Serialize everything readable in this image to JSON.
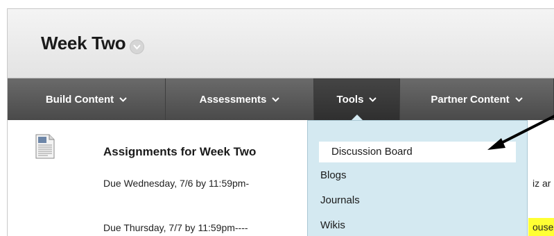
{
  "header": {
    "title": "Week Two"
  },
  "nav": {
    "items": [
      {
        "label": "Build Content"
      },
      {
        "label": "Assessments"
      },
      {
        "label": "Tools"
      },
      {
        "label": "Partner Content"
      }
    ]
  },
  "content": {
    "title": "Assignments for Week Two",
    "line1": "Due Wednesday, 7/6 by 11:59pm-",
    "line1_tail": "iz ar",
    "line2": "Due Thursday, 7/7 by 11:59pm----",
    "line2_tail": "ouse"
  },
  "dropdown": {
    "items": [
      {
        "label": "Discussion Board"
      },
      {
        "label": "Blogs"
      },
      {
        "label": "Journals"
      },
      {
        "label": "Wikis"
      }
    ]
  },
  "colors": {
    "nav_bg": "#5a5a5a",
    "nav_active": "#383838",
    "dropdown_bg": "#d4e9f1",
    "highlight": "#ffff33",
    "annotation_arrow": "#000000"
  }
}
